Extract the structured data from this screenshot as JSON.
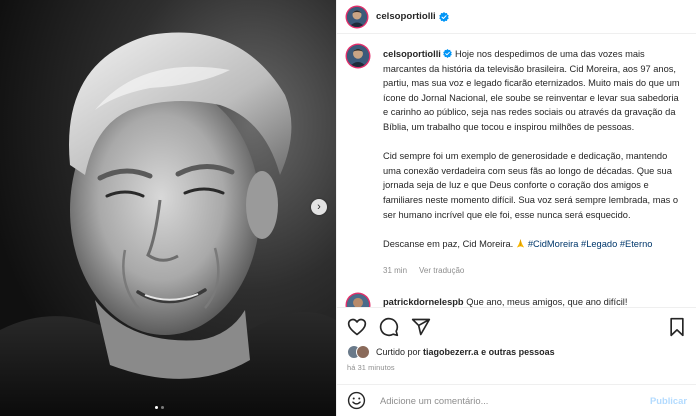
{
  "post": {
    "username": "celsoportiolli",
    "caption": {
      "paragraph1": "Hoje nos despedimos de uma das vozes mais marcantes da história da televisão brasileira. Cid Moreira, aos 97 anos, partiu, mas sua voz e legado ficarão eternizados. Muito mais do que um ícone do Jornal Nacional, ele soube se reinventar e levar sua sabedoria e carinho ao público, seja nas redes sociais ou através da gravação da Bíblia, um trabalho que tocou e inspirou milhões de pessoas.",
      "paragraph2": "Cid sempre foi um exemplo de generosidade e dedicação, mantendo uma conexão verdadeira com seus fãs ao longo de décadas. Que sua jornada seja de luz e que Deus conforte o coração dos amigos e familiares neste momento difícil. Sua voz será sempre lembrada, mas o ser humano incrível que ele foi, esse nunca será esquecido.",
      "closing": "Descanse em paz, Cid Moreira.",
      "hashtags": [
        "#CidMoreira",
        "#Legado",
        "#Eterno"
      ]
    },
    "caption_time": "31 min",
    "translate_label": "Ver tradução",
    "comment": {
      "username": "patrickdornelespb",
      "text": "Que ano, meus amigos, que ano difícil!"
    },
    "likes": {
      "prefix": "Curtido por",
      "user": "tiagobezerr.a",
      "suffix": "e outras pessoas"
    },
    "timestamp": "há 31 minutos",
    "add_comment_placeholder": "Adicione um comentário...",
    "publish_label": "Publicar",
    "carousel": {
      "slides": 2,
      "active": 1
    },
    "colors": {
      "hashtag": "#00376b",
      "secondary_text": "#8e8e8e",
      "publish_disabled": "#b3dbff",
      "verified": "#0095f6"
    },
    "icons": [
      "verified-icon",
      "heart-icon",
      "comment-icon",
      "share-icon",
      "bookmark-icon",
      "emoji-icon",
      "chevron-right-icon",
      "praying-hands-icon"
    ]
  }
}
